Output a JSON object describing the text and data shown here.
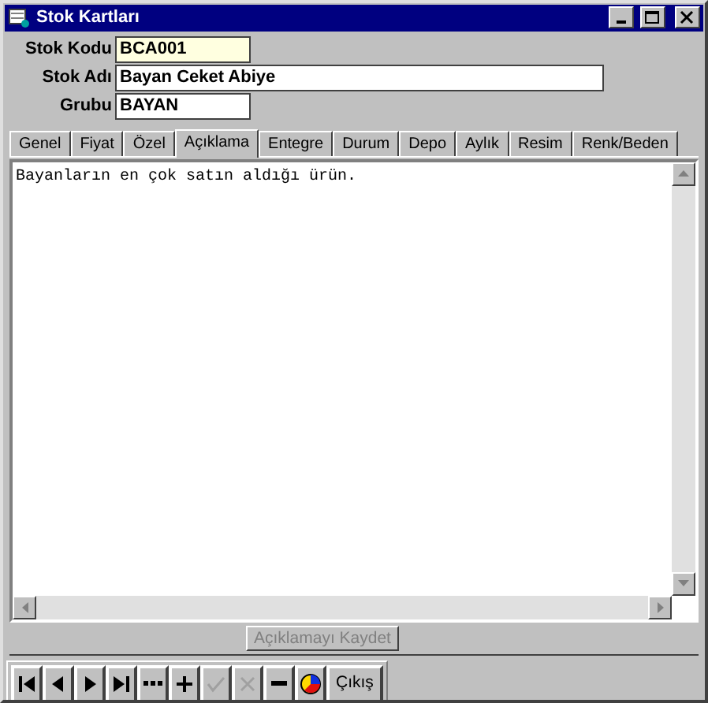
{
  "window": {
    "title": "Stok Kartları"
  },
  "fields": [
    {
      "label": "Stok Kodu",
      "value": "BCA001",
      "highlighted": true,
      "wide": false
    },
    {
      "label": "Stok Adı",
      "value": "Bayan Ceket Abiye",
      "highlighted": false,
      "wide": true
    },
    {
      "label": "Grubu",
      "value": "BAYAN",
      "highlighted": false,
      "wide": false
    }
  ],
  "tabs": [
    {
      "label": "Genel",
      "selected": false
    },
    {
      "label": "Fiyat",
      "selected": false
    },
    {
      "label": "Özel",
      "selected": false
    },
    {
      "label": "Açıklama",
      "selected": true
    },
    {
      "label": "Entegre",
      "selected": false
    },
    {
      "label": "Durum",
      "selected": false
    },
    {
      "label": "Depo",
      "selected": false
    },
    {
      "label": "Aylık",
      "selected": false
    },
    {
      "label": "Resim",
      "selected": false
    },
    {
      "label": "Renk/Beden",
      "selected": false
    }
  ],
  "memo": {
    "value": "Bayanların en çok satın aldığı ürün."
  },
  "save_button": {
    "label": "Açıklamayı Kaydet",
    "disabled": true
  },
  "navigator": [
    {
      "kind": "first",
      "disabled": false
    },
    {
      "kind": "prior",
      "disabled": false
    },
    {
      "kind": "next",
      "disabled": false
    },
    {
      "kind": "last",
      "disabled": false
    },
    {
      "kind": "more",
      "disabled": false
    },
    {
      "kind": "insert",
      "disabled": false
    },
    {
      "kind": "post",
      "disabled": true
    },
    {
      "kind": "cancel",
      "disabled": true
    },
    {
      "kind": "delete",
      "disabled": false
    },
    {
      "kind": "chart",
      "disabled": false
    }
  ],
  "exit_button": {
    "label": "Çıkış"
  }
}
